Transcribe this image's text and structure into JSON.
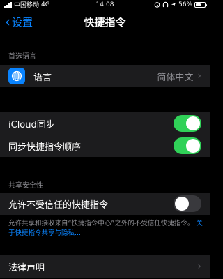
{
  "status_bar": {
    "carrier": "中国移动",
    "network": "4G",
    "time": "14:08",
    "battery_text": "56%",
    "battery_level": 0.56
  },
  "nav": {
    "back_label": "设置",
    "title": "快捷指令"
  },
  "language_section": {
    "header": "首选语言",
    "row_label": "语言",
    "row_value": "简体中文"
  },
  "sync_section": {
    "icloud_label": "iCloud同步",
    "icloud_on": true,
    "order_label": "同步快捷指令顺序",
    "order_on": true
  },
  "security_section": {
    "header": "共享安全性",
    "untrusted_label": "允许不受信任的快捷指令",
    "untrusted_on": false,
    "footnote_text": "允许共享和接收来自“快捷指令中心”之外的不受信任快捷指令。",
    "footnote_link": "关于快捷指令共享与隐私..."
  },
  "legal": {
    "row_label": "法律声明"
  },
  "colors": {
    "accent": "#0a84ff",
    "toggle_on": "#30d158",
    "toggle_off": "#39393d",
    "cell_bg": "#1c1c1e"
  },
  "icons": {
    "language": "globe-icon",
    "back": "chevron-left-icon",
    "disclosure": "chevron-right-icon"
  }
}
